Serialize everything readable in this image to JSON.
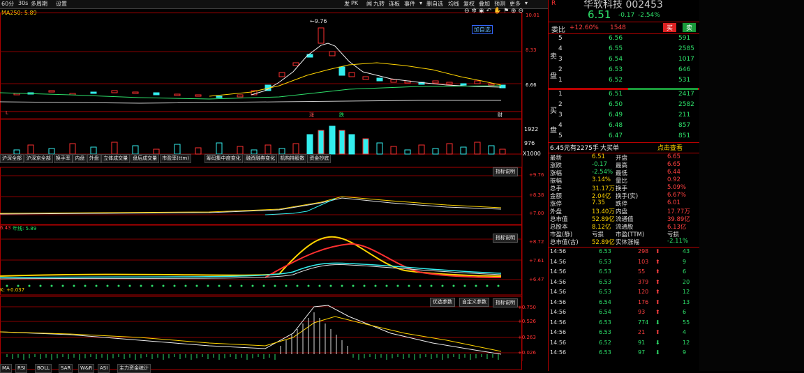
{
  "toolbar": {
    "period": "60分",
    "interval": "30s",
    "ma_style": "多周期",
    "settings": "设置",
    "right_tools": [
      "发",
      "PK",
      "闻",
      "九转",
      "连板",
      "事件",
      "▾",
      "删自选",
      "均线",
      "复权",
      "叠加",
      "预测",
      "更多",
      "▾"
    ]
  },
  "main_chart": {
    "ma_label": "MA250: 5.89",
    "peak_label": "9.76",
    "add_favorite": "加自选",
    "y_ticks": [
      "10.01",
      "8.33",
      "6.66"
    ],
    "markers": [
      "L",
      "涨",
      "跌",
      "财"
    ]
  },
  "volume_chart": {
    "y_ticks": [
      "1922",
      "976",
      "X1000"
    ]
  },
  "indicator_tabs": [
    "沪深全部",
    "沪深京全部",
    "换手率",
    "内盘",
    "外盘",
    "立体成交量",
    "盘后成交量",
    "市盈率(ttm)",
    "筹码集中度变化",
    "融资融券变化",
    "机构持股数",
    "资金抄底"
  ],
  "indicator_panes": [
    {
      "help": "指标说明",
      "ticks": [
        "+9.76",
        "+8.38",
        "+7.00"
      ],
      "label": ""
    },
    {
      "help": "指标说明",
      "ticks": [
        "+8.72",
        "+7.61",
        "+6.47"
      ],
      "label_left": "6.43",
      "label_mid": "年线: 5.89"
    },
    {
      "help": "指标说明",
      "ticks": [
        "+0.750",
        "+0.526",
        "+0.263",
        "+0.026"
      ],
      "label_left": "K: +0.037",
      "buttons": [
        "优选参数",
        "自定义参数"
      ]
    }
  ],
  "bottom_tabs": [
    "MA",
    "RSI",
    "BOLL",
    "SAR",
    "W&R",
    "ASI",
    "主力资金统计"
  ],
  "quote": {
    "r": "R",
    "stock_name": "华软科技 002453",
    "price": "6.51",
    "change": "-0.17",
    "change_pct": "-2.54%",
    "weibi_label": "委比",
    "weibi_value": "+12.60%",
    "weicha_value": "1548",
    "sell_btn": "买",
    "buy_btn": "卖",
    "sell_side_label": "卖盘",
    "buy_side_label": "买盘",
    "asks": [
      {
        "level": "5",
        "price": "6.56",
        "vol": "591"
      },
      {
        "level": "4",
        "price": "6.55",
        "vol": "2585"
      },
      {
        "level": "3",
        "price": "6.54",
        "vol": "1017"
      },
      {
        "level": "2",
        "price": "6.53",
        "vol": "646"
      },
      {
        "level": "1",
        "price": "6.52",
        "vol": "531"
      }
    ],
    "bids": [
      {
        "level": "1",
        "price": "6.51",
        "vol": "2417"
      },
      {
        "level": "2",
        "price": "6.50",
        "vol": "2582"
      },
      {
        "level": "3",
        "price": "6.49",
        "vol": "211"
      },
      {
        "level": "4",
        "price": "6.48",
        "vol": "857"
      },
      {
        "level": "5",
        "price": "6.47",
        "vol": "851"
      }
    ],
    "big_order_amount": "6.45元有",
    "big_order_vol": "2275手",
    "big_order_text": "大买单",
    "big_order_link": "点击查看",
    "stats": [
      [
        "最新",
        "6.51",
        "开盘",
        "6.65"
      ],
      [
        "涨跌",
        "-0.17",
        "最高",
        "6.65"
      ],
      [
        "涨幅",
        "-2.54%",
        "最低",
        "6.44"
      ],
      [
        "振幅",
        "3.14%",
        "量比",
        "0.92"
      ],
      [
        "总手",
        "31.17万",
        "换手",
        "5.09%"
      ],
      [
        "金额",
        "2.04亿",
        "换手(实)",
        "6.67%"
      ],
      [
        "涨停",
        "7.35",
        "跌停",
        "6.01"
      ],
      [
        "外盘",
        "13.40万",
        "内盘",
        "17.77万"
      ],
      [
        "总市值",
        "52.89亿",
        "流通值",
        "39.89亿"
      ],
      [
        "总股本",
        "8.12亿",
        "流通股",
        "6.13亿"
      ],
      [
        "市盈(静)",
        "亏损",
        "市盈(TTM)",
        "亏损"
      ],
      [
        "总市值(古)",
        "52.89亿",
        "实体涨幅",
        "-2.11%"
      ]
    ],
    "ticks": [
      {
        "time": "14:56",
        "price": "6.53",
        "vol": "298",
        "dir": "up",
        "extra": "43"
      },
      {
        "time": "14:56",
        "price": "6.53",
        "vol": "103",
        "dir": "up",
        "extra": "9"
      },
      {
        "time": "14:56",
        "price": "6.53",
        "vol": "55",
        "dir": "up",
        "extra": "6"
      },
      {
        "time": "14:56",
        "price": "6.53",
        "vol": "379",
        "dir": "up",
        "extra": "20"
      },
      {
        "time": "14:56",
        "price": "6.53",
        "vol": "120",
        "dir": "up",
        "extra": "12"
      },
      {
        "time": "14:56",
        "price": "6.54",
        "vol": "176",
        "dir": "up",
        "extra": "13"
      },
      {
        "time": "14:56",
        "price": "6.54",
        "vol": "93",
        "dir": "up",
        "extra": "6"
      },
      {
        "time": "14:56",
        "price": "6.53",
        "vol": "774",
        "dir": "down",
        "extra": "55"
      },
      {
        "time": "14:56",
        "price": "6.53",
        "vol": "21",
        "dir": "up",
        "extra": "4"
      },
      {
        "time": "14:56",
        "price": "6.52",
        "vol": "91",
        "dir": "down",
        "extra": "12"
      },
      {
        "time": "14:56",
        "price": "6.53",
        "vol": "97",
        "dir": "down",
        "extra": "9"
      }
    ]
  },
  "colors": {
    "up": "#ff3030",
    "down": "#2ee06a",
    "frame": "#b00000",
    "yellow": "#ffd400"
  }
}
